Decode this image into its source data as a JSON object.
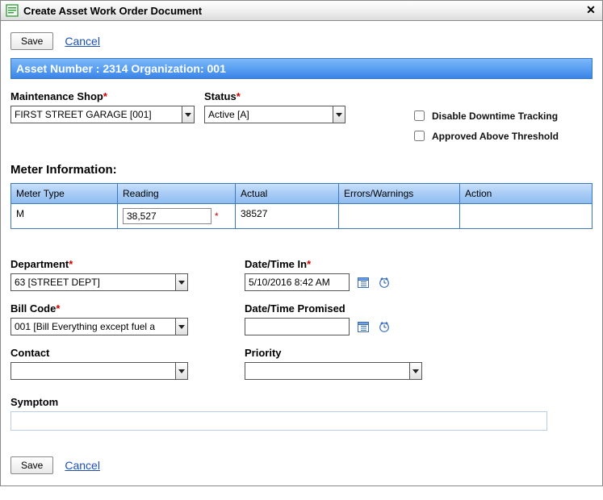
{
  "title": "Create Asset Work Order Document",
  "actions": {
    "save_label": "Save",
    "cancel_label": "Cancel"
  },
  "banner": "Asset Number : 2314 Organization: 001",
  "upper": {
    "shop_label": "Maintenance Shop",
    "shop_value": "FIRST STREET GARAGE [001]",
    "status_label": "Status",
    "status_value": "Active [A]"
  },
  "checks": {
    "disable_downtime": "Disable Downtime Tracking",
    "approved_above": "Approved Above Threshold"
  },
  "meter": {
    "heading": "Meter Information:",
    "cols": {
      "meter_type": "Meter Type",
      "reading": "Reading",
      "actual": "Actual",
      "errors": "Errors/Warnings",
      "action": "Action"
    },
    "row": {
      "meter_type": "M",
      "reading": "38,527",
      "actual": "38527",
      "errors": "",
      "action": ""
    }
  },
  "form": {
    "department_label": "Department",
    "department_value": "63 [STREET DEPT]",
    "billcode_label": "Bill Code",
    "billcode_value": "001 [Bill Everything except fuel a",
    "contact_label": "Contact",
    "contact_value": "",
    "datetime_in_label": "Date/Time In",
    "datetime_in_value": "5/10/2016 8:42 AM",
    "datetime_promised_label": "Date/Time Promised",
    "datetime_promised_value": "",
    "priority_label": "Priority",
    "priority_value": "",
    "symptom_label": "Symptom",
    "symptom_value": ""
  }
}
